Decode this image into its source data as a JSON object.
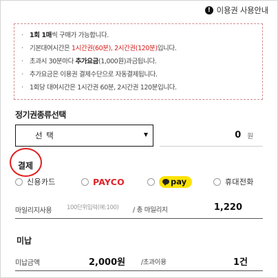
{
  "header": {
    "guide_label": "이용권 사용안내",
    "guide_icon": "info-icon"
  },
  "notice": {
    "items": [
      {
        "bullet": "·",
        "parts": [
          {
            "text": "1회 1매",
            "style": "bold"
          },
          {
            "text": "씩 구매가 가능합니다.",
            "style": "normal"
          }
        ]
      },
      {
        "bullet": "·",
        "parts": [
          {
            "text": "기본대여시간은 ",
            "style": "normal"
          },
          {
            "text": "1시간권(60분), 2시간권(120분)",
            "style": "red"
          },
          {
            "text": "입니다.",
            "style": "normal"
          }
        ]
      },
      {
        "bullet": "·",
        "parts": [
          {
            "text": "초과시 30분마다 ",
            "style": "normal"
          },
          {
            "text": "추가요금",
            "style": "bold"
          },
          {
            "text": "(1,000원)과금됩니다.",
            "style": "normal"
          }
        ]
      },
      {
        "bullet": "·",
        "parts": [
          {
            "text": "추가요금은 이용권 결제수단으로 자동결제됩니다.",
            "style": "normal"
          }
        ]
      },
      {
        "bullet": "·",
        "parts": [
          {
            "text": "1회당 대여시간은 1시간권 60분, 2시간권 120분입니다.",
            "style": "normal"
          }
        ]
      }
    ]
  },
  "ticket": {
    "section_label": "정기권종류선택",
    "select_value": "선 택",
    "amount": "0",
    "amount_unit": "원"
  },
  "payment": {
    "section_label": "결제",
    "options": [
      {
        "label": "신용카드",
        "type": "text"
      },
      {
        "label": "PAYCO",
        "type": "payco"
      },
      {
        "label": "pay",
        "type": "kakaopay"
      },
      {
        "label": "휴대전화",
        "type": "text"
      }
    ]
  },
  "mileage": {
    "label": "마일리지사용",
    "placeholder": "100단위입력(예:100)",
    "total_label": "/ 총 마일리지",
    "total": "1,220"
  },
  "unpaid": {
    "section_label": "미납",
    "amount_label": "미납금액",
    "amount": "2,000원",
    "count_label": "/초과이용",
    "count": "1건"
  },
  "colors": {
    "notice_border": "#d08a8a",
    "highlight_red": "#d31c1c",
    "annotation_ring": "#e02020",
    "payco_red": "#e1242b",
    "kakao_yellow": "#ffe300"
  }
}
